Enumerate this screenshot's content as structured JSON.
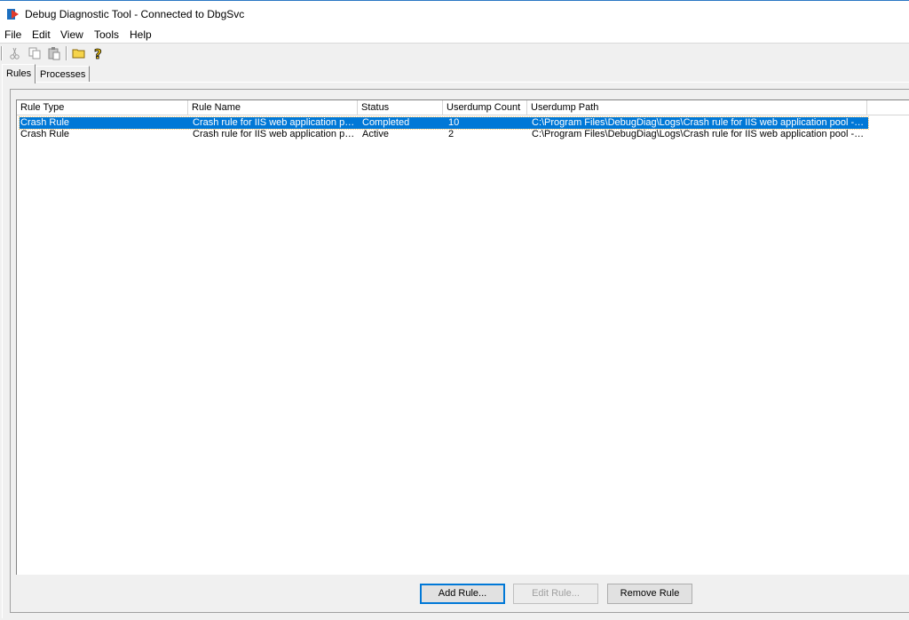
{
  "window": {
    "title": "Debug Diagnostic Tool - Connected to DbgSvc"
  },
  "menu": {
    "items": [
      "File",
      "Edit",
      "View",
      "Tools",
      "Help"
    ]
  },
  "toolbar": {
    "buttons": [
      "cut-icon",
      "copy-icon",
      "paste-icon",
      "open-folder-icon",
      "help-icon"
    ]
  },
  "tabs": [
    {
      "label": "Rules",
      "active": true
    },
    {
      "label": "Processes",
      "active": false
    }
  ],
  "rules_list": {
    "columns": [
      "Rule Type",
      "Rule Name",
      "Status",
      "Userdump Count",
      "Userdump Path"
    ],
    "rows": [
      {
        "rule_type": "Crash Rule",
        "rule_name": "Crash rule for IIS web application po…",
        "status": "Completed",
        "userdump_count": "10",
        "userdump_path": "C:\\Program Files\\DebugDiag\\Logs\\Crash rule for IIS web application pool - De…",
        "selected": true
      },
      {
        "rule_type": "Crash Rule",
        "rule_name": "Crash rule for IIS web application po…",
        "status": "Active",
        "userdump_count": "2",
        "userdump_path": "C:\\Program Files\\DebugDiag\\Logs\\Crash rule for IIS web application pool - Tes…",
        "selected": false
      }
    ]
  },
  "buttons": {
    "add_rule": "Add Rule...",
    "edit_rule": "Edit Rule...",
    "remove_rule": "Remove Rule"
  },
  "colors": {
    "selection": "#0078d7",
    "title_border": "#2b78c4"
  }
}
